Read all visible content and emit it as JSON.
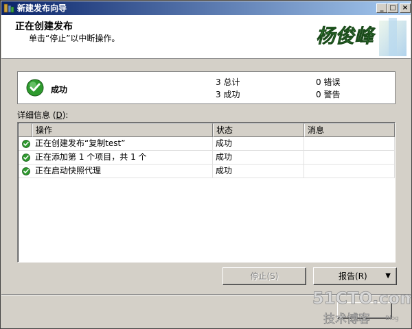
{
  "window": {
    "title": "新建发布向导",
    "controls": {
      "minimize": "_",
      "maximize": "□",
      "close": "×"
    }
  },
  "header": {
    "title": "正在创建发布",
    "subtitle": "单击“停止”以中断操作。",
    "logo_text": "杨俊峰"
  },
  "summary": {
    "status": "成功",
    "stats": [
      {
        "value": "3",
        "label": "总计"
      },
      {
        "value": "3",
        "label": "成功"
      },
      {
        "value": "0",
        "label": "错误"
      },
      {
        "value": "0",
        "label": "警告"
      }
    ]
  },
  "details": {
    "label_prefix": "详细信息 (",
    "label_key": "D",
    "label_suffix": "):",
    "columns": [
      "操作",
      "状态",
      "消息"
    ],
    "rows": [
      {
        "action": "正在创建发布“复制test”",
        "status": "成功",
        "message": ""
      },
      {
        "action": "正在添加第 1 个项目，共 1 个",
        "status": "成功",
        "message": ""
      },
      {
        "action": "正在启动快照代理",
        "status": "成功",
        "message": ""
      }
    ]
  },
  "buttons": {
    "stop": "停止(S)",
    "report": "报告(R)",
    "report_arrow": "▼"
  },
  "watermark": {
    "site": "51CTO.com",
    "sub": "技术博客",
    "blog": "Blog"
  },
  "colors": {
    "success_green": "#2e9a2e",
    "title_blue": "#0a246a"
  }
}
